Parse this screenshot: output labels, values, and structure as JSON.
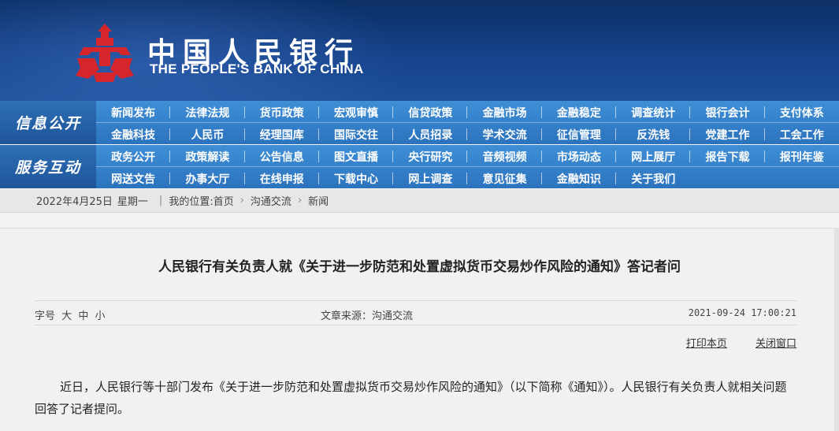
{
  "brand": {
    "name_cn": "中国人民银行",
    "name_en": "THE PEOPLE'S BANK OF CHINA",
    "logo_color": "#d6262b"
  },
  "nav": {
    "block1": {
      "category": "信息公开",
      "row1": [
        "新闻发布",
        "法律法规",
        "货币政策",
        "宏观审慎",
        "信贷政策",
        "金融市场",
        "金融稳定",
        "调查统计",
        "银行会计",
        "支付体系"
      ],
      "row2": [
        "金融科技",
        "人民币",
        "经理国库",
        "国际交往",
        "人员招录",
        "学术交流",
        "征信管理",
        "反洗钱",
        "党建工作",
        "工会工作"
      ]
    },
    "block2": {
      "category": "服务互动",
      "row1": [
        "政务公开",
        "政策解读",
        "公告信息",
        "图文直播",
        "央行研究",
        "音频视频",
        "市场动态",
        "网上展厅",
        "报告下载",
        "报刊年鉴"
      ],
      "row2": [
        "网送文告",
        "办事大厅",
        "在线申报",
        "下载中心",
        "网上调查",
        "意见征集",
        "金融知识",
        "关于我们"
      ]
    }
  },
  "breadcrumb": {
    "date": "2022年4月25日",
    "weekday": "星期一",
    "location_label": "我的位置:",
    "home": "首页",
    "section": "沟通交流",
    "page": "新闻"
  },
  "article": {
    "title": "人民银行有关负责人就《关于进一步防范和处置虚拟货币交易炒作风险的通知》答记者问",
    "fontsize_label": "字号",
    "fontsize_large": "大",
    "fontsize_medium": "中",
    "fontsize_small": "小",
    "source": "文章来源：沟通交流",
    "datetime": "2021-09-24 17:00:21",
    "print_label": "打印本页",
    "close_label": "关闭窗口",
    "paragraph": "近日，人民银行等十部门发布《关于进一步防范和处置虚拟货币交易炒作风险的通知》（以下简称《通知》）。人民银行有关负责人就相关问题回答了记者提问。"
  }
}
